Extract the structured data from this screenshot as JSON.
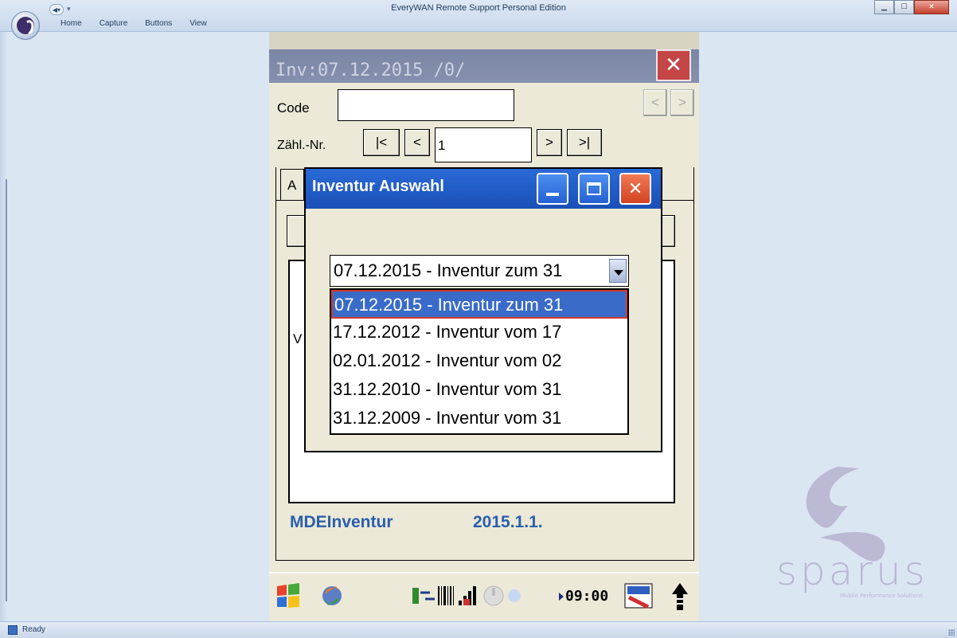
{
  "window": {
    "title": "EveryWAN Remote Support Personal Edition",
    "menu": [
      "Home",
      "Capture",
      "Buttons",
      "View"
    ],
    "status": "Ready"
  },
  "device": {
    "title": "Inv:07.12.2015 /0/",
    "close_label": "✕",
    "code_label": "Code",
    "code_value": "",
    "nav_prev": "<",
    "nav_next": ">",
    "count_label": "Zähl.-Nr.",
    "first_label": "|<",
    "prev_label": "<",
    "count_value": "1",
    "next_label": ">",
    "last_label": ">|",
    "tab_label": "A",
    "panel_char": "V",
    "app_name": "MDEInventur",
    "app_version": "2015.1.1."
  },
  "dialog": {
    "title": "Inventur Auswahl",
    "selected": "07.12.2015 - Inventur zum 31",
    "options": [
      "07.12.2015 - Inventur zum 31",
      "17.12.2012 - Inventur vom 17",
      "02.01.2012 - Inventur vom 02",
      "31.12.2010 - Inventur vom 31",
      "31.12.2009 - Inventur vom 31"
    ]
  },
  "taskbar": {
    "clock": "09:00",
    "icons": [
      "start-flag-icon",
      "sync-icon",
      "connection-icon",
      "barcode-icon",
      "signal-icon",
      "volume-icon",
      "keyboard-icon",
      "arrow-up-icon"
    ]
  },
  "logo": {
    "word": "sparus",
    "tagline": "Mobile Performance Solutions"
  },
  "colors": {
    "dialog_title": "#1a4fb6",
    "selection": "#3a6bc8",
    "app_text": "#2b5fad",
    "device_title": "#7b86a6"
  }
}
